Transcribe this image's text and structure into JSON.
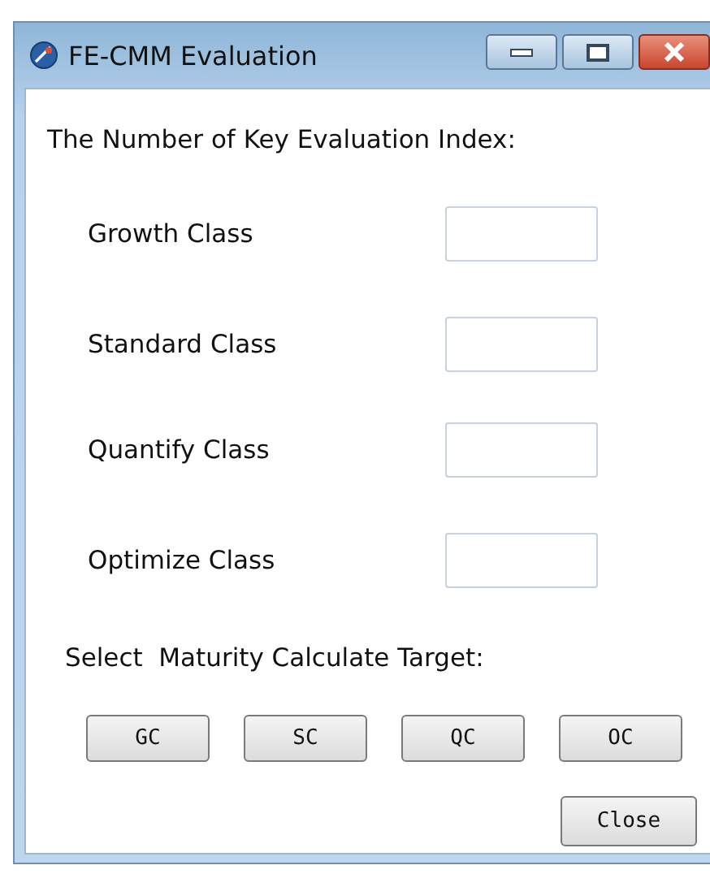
{
  "window": {
    "title": "FE-CMM Evaluation"
  },
  "heading": "The Number of Key Evaluation Index:",
  "fields": [
    {
      "label": "Growth Class"
    },
    {
      "label": "Standard Class"
    },
    {
      "label": "Quantify Class"
    },
    {
      "label": "Optimize Class"
    }
  ],
  "select_label": "Select  Maturity Calculate Target:",
  "target_buttons": [
    "GC",
    "SC",
    "QC",
    "OC"
  ],
  "close_button": "Close"
}
